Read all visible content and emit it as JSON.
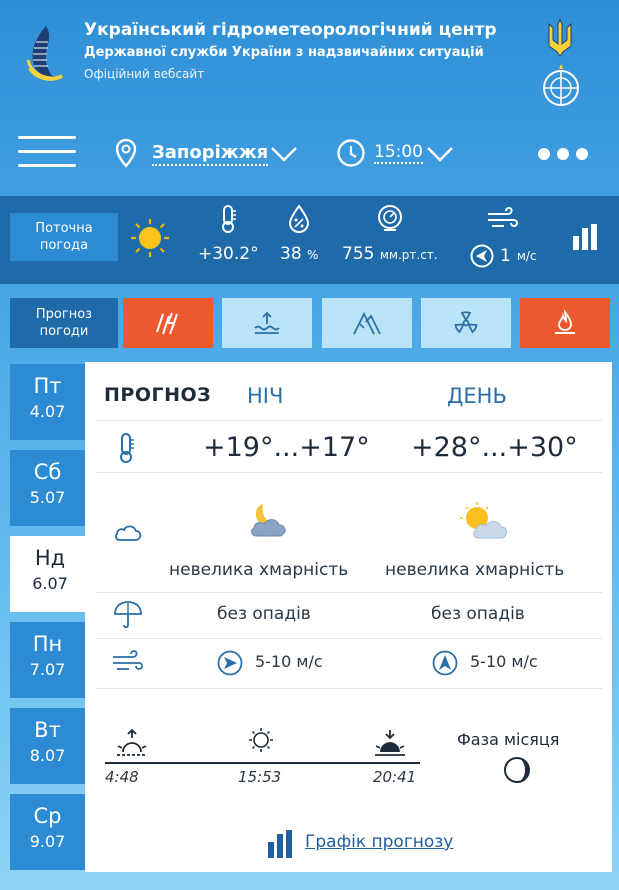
{
  "header": {
    "title": "Український гідрометеорологічний центр",
    "subtitle": "Державної служби України з надзвичайних ситуацій",
    "site": "Офіційний вебсайт"
  },
  "nav": {
    "city": "Запоріжжя",
    "time": "15:00"
  },
  "current": {
    "label_line1": "Поточна",
    "label_line2": "погода",
    "temperature": "+30.2°",
    "humidity_value": "38",
    "humidity_unit": "%",
    "pressure_value": "755",
    "pressure_unit": "мм.рт.ст.",
    "wind_value": "1",
    "wind_unit": "м/с"
  },
  "forecast_tabs": {
    "label_line1": "Прогноз",
    "label_line2": "погоди",
    "tabs": [
      {
        "icon": "thunder-icon",
        "active": true
      },
      {
        "icon": "water-level-icon",
        "active": false
      },
      {
        "icon": "mountains-icon",
        "active": false
      },
      {
        "icon": "radiation-icon",
        "active": false
      },
      {
        "icon": "fire-icon",
        "active": true
      }
    ]
  },
  "days": [
    {
      "name": "Пт",
      "date": "4.07"
    },
    {
      "name": "Сб",
      "date": "5.07"
    },
    {
      "name": "Нд",
      "date": "6.07"
    },
    {
      "name": "Пн",
      "date": "7.07"
    },
    {
      "name": "Вт",
      "date": "8.07"
    },
    {
      "name": "Ср",
      "date": "9.07"
    }
  ],
  "forecast": {
    "heading": "ПРОГНОЗ",
    "night_label": "НІЧ",
    "day_label": "ДЕНЬ",
    "night_temp": "+19°...+17°",
    "day_temp": "+28°...+30°",
    "night_sky": "невелика хмарність",
    "day_sky": "невелика хмарність",
    "night_precip": "без опадів",
    "day_precip": "без опадів",
    "night_wind": "5-10 м/с",
    "day_wind": "5-10 м/с",
    "sunrise": "4:48",
    "solar_noon": "15:53",
    "sunset": "20:41",
    "moon_phase_label": "Фаза місяця",
    "graph_link": "Графік прогнозу"
  },
  "colors": {
    "orange": "#ee5a2f",
    "dark_blue": "#1f6aa8",
    "mid_blue": "#2d8bd4",
    "light_tab": "#b9e3f6",
    "link": "#1f5fa0"
  }
}
